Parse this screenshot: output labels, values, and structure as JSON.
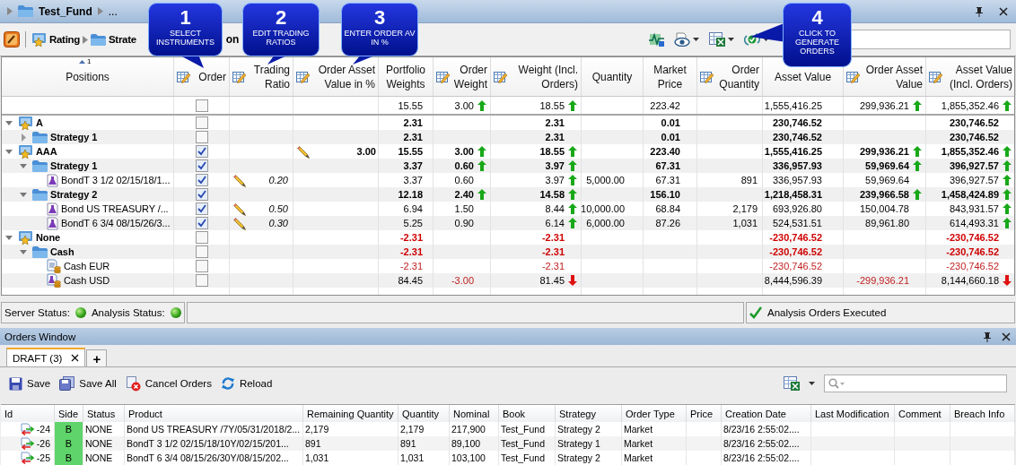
{
  "title_bar": {
    "title": "Test_Fund",
    "overflow": "..."
  },
  "toolbar": {
    "path": [
      {
        "label": "Rating",
        "kind": "portfolio"
      },
      {
        "label": "Strate",
        "kind": "strategy"
      }
    ],
    "path_tail": "on"
  },
  "callouts": [
    {
      "number": "1",
      "text": "SELECT INSTRUMENTS"
    },
    {
      "number": "2",
      "text": "EDIT TRADING RATIOS"
    },
    {
      "number": "3",
      "text": "ENTER ORDER AV  IN %"
    },
    {
      "number": "4",
      "text": "CLICK TO GENERATE ORDERS"
    }
  ],
  "positions": {
    "sort_indicator": "1",
    "columns": [
      {
        "label": "Positions",
        "editable": false
      },
      {
        "label": "Order",
        "editable": true
      },
      {
        "label": "Trading Ratio",
        "editable": true
      },
      {
        "label": "Order Asset Value in %",
        "editable": true
      },
      {
        "label": "Portfolio Weights",
        "editable": false
      },
      {
        "label": "Order Weight",
        "editable": true
      },
      {
        "label": "Weight (Incl. Orders)",
        "editable": true
      },
      {
        "label": "Quantity",
        "editable": false
      },
      {
        "label": "Market Price",
        "editable": false
      },
      {
        "label": "Order Quantity",
        "editable": true
      },
      {
        "label": "Asset Value",
        "editable": false
      },
      {
        "label": "Order Asset Value",
        "editable": true
      },
      {
        "label": "Asset Value (Incl. Orders)",
        "editable": true
      }
    ],
    "summary": {
      "cells": [
        null,
        {
          "checked": false
        },
        null,
        null,
        "15.55",
        {
          "value": "3.00",
          "rising": true
        },
        {
          "value": "18.55",
          "rising": true
        },
        null,
        "223.42",
        null,
        "1,555,416.25",
        {
          "value": "299,936.21",
          "rising": true
        },
        {
          "value": "1,855,352.46",
          "rising": true
        }
      ]
    },
    "rows": [
      {
        "kind": "portfolio",
        "expanded": true,
        "cells": [
          "A",
          {
            "checked": false
          },
          null,
          null,
          "2.31",
          null,
          "2.31",
          null,
          "0.01",
          null,
          "230,746.52",
          null,
          "230,746.52"
        ],
        "children": [
          {
            "kind": "strategy",
            "expanded": false,
            "cells": [
              "Strategy 1",
              {
                "checked": false
              },
              null,
              null,
              "2.31",
              null,
              "2.31",
              null,
              "0.01",
              null,
              "230,746.52",
              null,
              "230,746.52"
            ]
          }
        ]
      },
      {
        "kind": "portfolio",
        "expanded": true,
        "cells": [
          "AAA",
          {
            "checked": true
          },
          null,
          {
            "value": "3.00",
            "editable": true
          },
          "15.55",
          {
            "value": "3.00",
            "rising": true
          },
          {
            "value": "18.55",
            "rising": true
          },
          null,
          "223.40",
          null,
          "1,555,416.25",
          {
            "value": "299,936.21",
            "rising": true
          },
          {
            "value": "1,855,352.46",
            "rising": true
          }
        ],
        "children": [
          {
            "kind": "strategy",
            "expanded": true,
            "cells": [
              "Strategy 1",
              {
                "checked": true
              },
              null,
              null,
              "3.37",
              {
                "value": "0.60",
                "rising": true
              },
              {
                "value": "3.97",
                "rising": true
              },
              null,
              "67.31",
              null,
              "336,957.93",
              {
                "value": "59,969.64",
                "rising": true
              },
              {
                "value": "396,927.57",
                "rising": true
              }
            ],
            "children": [
              {
                "kind": "bond",
                "cells": [
                  "BondT 3 1/2 02/15/18/1...",
                  {
                    "checked": true
                  },
                  {
                    "value": "0.20",
                    "editable": true
                  },
                  null,
                  "3.37",
                  "0.60",
                  {
                    "value": "3.97",
                    "rising": true
                  },
                  "5,000.00",
                  "67.31",
                  "891",
                  "336,957.93",
                  "59,969.64",
                  {
                    "value": "396,927.57",
                    "rising": true
                  }
                ]
              }
            ]
          },
          {
            "kind": "strategy",
            "expanded": true,
            "cells": [
              "Strategy 2",
              {
                "checked": true
              },
              null,
              null,
              "12.18",
              {
                "value": "2.40",
                "rising": true
              },
              {
                "value": "14.58",
                "rising": true
              },
              null,
              "156.10",
              null,
              "1,218,458.31",
              {
                "value": "239,966.58",
                "rising": true
              },
              {
                "value": "1,458,424.89",
                "rising": true
              }
            ],
            "children": [
              {
                "kind": "bond",
                "cells": [
                  "Bond US TREASURY /...",
                  {
                    "checked": true
                  },
                  {
                    "value": "0.50",
                    "editable": true
                  },
                  null,
                  "6.94",
                  "1.50",
                  {
                    "value": "8.44",
                    "rising": true
                  },
                  "10,000.00",
                  "68.84",
                  "2,179",
                  "693,926.80",
                  "150,004.78",
                  {
                    "value": "843,931.57",
                    "rising": true
                  }
                ]
              },
              {
                "kind": "bond",
                "cells": [
                  "BondT 6 3/4 08/15/26/3...",
                  {
                    "checked": true
                  },
                  {
                    "value": "0.30",
                    "editable": true
                  },
                  null,
                  "5.25",
                  "0.90",
                  {
                    "value": "6.14",
                    "rising": true
                  },
                  "6,000.00",
                  "87.26",
                  "1,031",
                  "524,531.51",
                  "89,961.80",
                  {
                    "value": "614,493.31",
                    "rising": true
                  }
                ]
              }
            ]
          }
        ]
      },
      {
        "kind": "portfolio",
        "expanded": true,
        "cells": [
          "None",
          {
            "checked": false
          },
          null,
          null,
          {
            "value": "-2.31",
            "negative": true
          },
          null,
          {
            "value": "-2.31",
            "negative": true
          },
          null,
          null,
          null,
          {
            "value": "-230,746.52",
            "negative": true
          },
          null,
          {
            "value": "-230,746.52",
            "negative": true
          }
        ],
        "children": [
          {
            "kind": "strategy",
            "expanded": true,
            "cells": [
              "Cash",
              {
                "checked": false
              },
              null,
              null,
              {
                "value": "-2.31",
                "negative": true
              },
              null,
              {
                "value": "-2.31",
                "negative": true
              },
              null,
              null,
              null,
              {
                "value": "-230,746.52",
                "negative": true
              },
              null,
              {
                "value": "-230,746.52",
                "negative": true
              }
            ],
            "children": [
              {
                "kind": "cash_account",
                "cells": [
                  "Cash EUR",
                  {
                    "checked": false
                  },
                  null,
                  null,
                  {
                    "value": "-2.31",
                    "negative": true
                  },
                  null,
                  {
                    "value": "-2.31",
                    "negative": true
                  },
                  null,
                  null,
                  null,
                  {
                    "value": "-230,746.52",
                    "negative": true
                  },
                  null,
                  {
                    "value": "-230,746.52",
                    "negative": true
                  }
                ]
              },
              {
                "kind": "cash_position",
                "cells": [
                  "Cash USD",
                  {
                    "checked": false
                  },
                  null,
                  null,
                  "84.45",
                  {
                    "value": "-3.00",
                    "negative": true
                  },
                  {
                    "value": "81.45",
                    "rising": false
                  },
                  null,
                  null,
                  null,
                  "8,444,596.39",
                  {
                    "value": "-299,936.21",
                    "negative": true
                  },
                  {
                    "value": "8,144,660.18",
                    "rising": false
                  }
                ]
              }
            ]
          }
        ]
      }
    ]
  },
  "status_bar": {
    "items": [
      {
        "label": "Server Status:",
        "ok": true
      },
      {
        "label": "Analysis Status:",
        "ok": true
      }
    ],
    "message": "Analysis Orders Executed"
  },
  "orders_window": {
    "title": "Orders Window",
    "tabs": [
      {
        "label": "DRAFT (3)",
        "selected": true,
        "closable": true
      },
      {
        "label": "+",
        "selected": false,
        "closable": false
      }
    ],
    "actions": [
      {
        "label": "Save",
        "kind": "save"
      },
      {
        "label": "Save All",
        "kind": "save_all"
      },
      {
        "label": "Cancel Orders",
        "kind": "cancel"
      },
      {
        "label": "Reload",
        "kind": "reload"
      }
    ],
    "columns": [
      "Id",
      "Side",
      "Status",
      "Product",
      "Remaining Quantity",
      "Quantity",
      "Nominal",
      "Book",
      "Strategy",
      "Order Type",
      "Price",
      "Creation Date",
      "Last Modification",
      "Comment",
      "Breach Info"
    ],
    "rows": [
      [
        "-24",
        "B",
        "NONE",
        "Bond US TREASURY /7Y/05/31/2018/2...",
        "2,179",
        "2,179",
        "217,900",
        "Test_Fund",
        "Strategy 2",
        "Market",
        null,
        "8/23/16 2:55:02....",
        null,
        null,
        null
      ],
      [
        "-26",
        "B",
        "NONE",
        "BondT 3 1/2 02/15/18/10Y/02/15/201...",
        "891",
        "891",
        "89,100",
        "Test_Fund",
        "Strategy 1",
        "Market",
        null,
        "8/23/16 2:55:02....",
        null,
        null,
        null
      ],
      [
        "-25",
        "B",
        "NONE",
        "BondT 6 3/4 08/15/26/30Y/08/15/202...",
        "1,031",
        "1,031",
        "103,100",
        "Test_Fund",
        "Strategy 2",
        "Market",
        null,
        "8/23/16 2:55:02....",
        null,
        null,
        null
      ]
    ]
  }
}
